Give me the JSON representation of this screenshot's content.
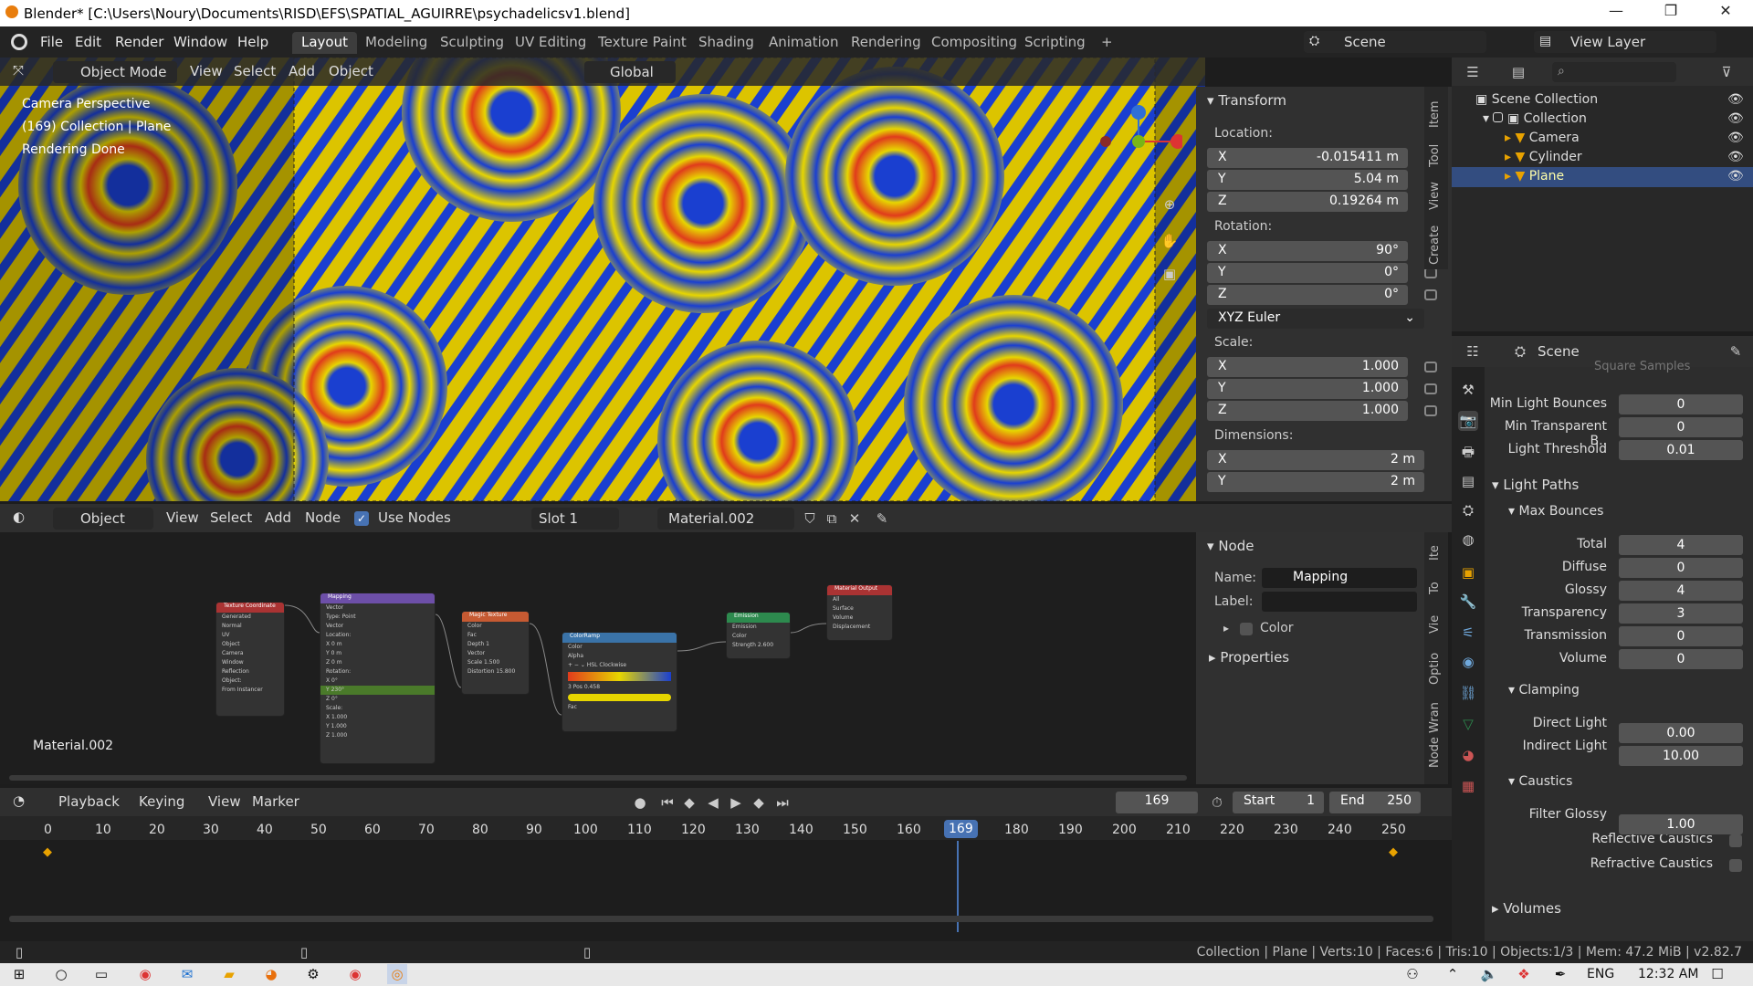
{
  "titlebar": {
    "title": "Blender* [C:\\Users\\Noury\\Documents\\RISD\\EFS\\SPATIAL_AGUIRRE\\psychadelicsv1.blend]",
    "minimize": "—",
    "maximize": "❐",
    "close": "✕"
  },
  "menu": [
    "File",
    "Edit",
    "Render",
    "Window",
    "Help"
  ],
  "workspaces": [
    "Layout",
    "Modeling",
    "Sculpting",
    "UV Editing",
    "Texture Paint",
    "Shading",
    "Animation",
    "Rendering",
    "Compositing",
    "Scripting",
    "+"
  ],
  "scene": {
    "label": "Scene",
    "view_layer": "View Layer"
  },
  "viewport": {
    "mode": "Object Mode",
    "menus": [
      "View",
      "Select",
      "Add",
      "Object"
    ],
    "orientation": "Global",
    "overlay_lines": [
      "Camera Perspective",
      "(169) Collection | Plane",
      "Rendering Done"
    ]
  },
  "npanel": {
    "title": "Transform",
    "tabs": [
      "Item",
      "Tool",
      "View",
      "Create"
    ],
    "location_label": "Location:",
    "location": [
      {
        "axis": "X",
        "value": "-0.015411 m"
      },
      {
        "axis": "Y",
        "value": "5.04 m"
      },
      {
        "axis": "Z",
        "value": "0.19264 m"
      }
    ],
    "rotation_label": "Rotation:",
    "rotation": [
      {
        "axis": "X",
        "value": "90°"
      },
      {
        "axis": "Y",
        "value": "0°"
      },
      {
        "axis": "Z",
        "value": "0°"
      }
    ],
    "rotation_mode": "XYZ Euler",
    "scale_label": "Scale:",
    "scale": [
      {
        "axis": "X",
        "value": "1.000"
      },
      {
        "axis": "Y",
        "value": "1.000"
      },
      {
        "axis": "Z",
        "value": "1.000"
      }
    ],
    "dimensions_label": "Dimensions:",
    "dimensions": [
      {
        "axis": "X",
        "value": "2 m"
      },
      {
        "axis": "Y",
        "value": "2 m"
      }
    ]
  },
  "nodeeditor": {
    "type": "Object",
    "menus": [
      "View",
      "Select",
      "Add",
      "Node"
    ],
    "use_nodes": "Use Nodes",
    "slot": "Slot 1",
    "material": "Material.002",
    "corner_label": "Material.002",
    "panel_title": "Node",
    "name_label": "Name:",
    "name_value": "Mapping",
    "label_label": "Label:",
    "color_label": "Color",
    "properties_label": "Properties",
    "tabs": [
      "Ite",
      "To",
      "Vie",
      "Optio",
      "Node Wran"
    ],
    "nodes": [
      {
        "title": "Texture Coordinate",
        "color": "#a33",
        "lines": [
          "Generated",
          "Normal",
          "UV",
          "Object",
          "Camera",
          "Window",
          "Reflection",
          "Object:",
          "From Instancer"
        ]
      },
      {
        "title": "Mapping",
        "color": "#6d4fa8",
        "lines": [
          "Vector",
          "Type: Point",
          "Vector",
          "Location:",
          "X 0 m",
          "Y 0 m",
          "Z 0 m",
          "Rotation:",
          "X 0°",
          "Y 230°",
          "Z 0°",
          "Scale:",
          "X 1.000",
          "Y 1.000",
          "Z 1.000"
        ]
      },
      {
        "title": "Magic Texture",
        "color": "#c65a32",
        "lines": [
          "Color",
          "Fac",
          "Depth 1",
          "Vector",
          "Scale 1.500",
          "Distortion 15.800"
        ]
      },
      {
        "title": "ColorRamp",
        "color": "#3a73a8",
        "lines": [
          "Color",
          "Alpha",
          "+ − ⌄ HSL Clockwise",
          "3 Pos 0.458",
          "Fac"
        ]
      },
      {
        "title": "Emission",
        "color": "#2d8a4e",
        "lines": [
          "Emission",
          "Color",
          "Strength 2.600"
        ]
      },
      {
        "title": "Material Output",
        "color": "#a33",
        "lines": [
          "All",
          "Surface",
          "Volume",
          "Displacement"
        ]
      }
    ]
  },
  "timeline": {
    "menus": [
      "Playback",
      "Keying",
      "View",
      "Marker"
    ],
    "current_frame": "169",
    "start_label": "Start",
    "start": "1",
    "end_label": "End",
    "end": "250",
    "ticks": [
      "0",
      "10",
      "20",
      "30",
      "40",
      "50",
      "60",
      "70",
      "80",
      "90",
      "100",
      "110",
      "120",
      "130",
      "140",
      "150",
      "160",
      "169",
      "180",
      "190",
      "200",
      "210",
      "220",
      "230",
      "240",
      "250"
    ]
  },
  "outliner": {
    "items": [
      {
        "label": "Scene Collection"
      },
      {
        "label": "Collection"
      },
      {
        "label": "Camera"
      },
      {
        "label": "Cylinder"
      },
      {
        "label": "Plane",
        "selected": true
      }
    ]
  },
  "properties": {
    "context": "Scene",
    "cut_text": "Square Samples",
    "rows1": [
      {
        "label": "Min Light Bounces",
        "value": "0"
      },
      {
        "label": "Min Transparent B..",
        "value": "0"
      },
      {
        "label": "Light Threshold",
        "value": "0.01"
      }
    ],
    "light_paths": "Light Paths",
    "max_bounces": "Max Bounces",
    "bounces": [
      {
        "label": "Total",
        "value": "4"
      },
      {
        "label": "Diffuse",
        "value": "0"
      },
      {
        "label": "Glossy",
        "value": "4"
      },
      {
        "label": "Transparency",
        "value": "3"
      },
      {
        "label": "Transmission",
        "value": "0"
      },
      {
        "label": "Volume",
        "value": "0"
      }
    ],
    "clamping": "Clamping",
    "clamp": [
      {
        "label": "Direct Light",
        "value": "0.00"
      },
      {
        "label": "Indirect Light",
        "value": "10.00"
      }
    ],
    "caustics": "Caustics",
    "filter_glossy_label": "Filter Glossy",
    "filter_glossy": "1.00",
    "reflective": "Reflective Caustics",
    "refractive": "Refractive Caustics",
    "volumes": "Volumes"
  },
  "statusbar": {
    "text": "Collection | Plane | Verts:10 | Faces:6 | Tris:10 | Objects:1/3 | Mem: 47.2 MiB | v2.82.7"
  },
  "taskbar": {
    "lang": "ENG",
    "time": "12:32 AM"
  },
  "colors": {
    "accent": "#4772b3",
    "selected_row": "#334d80",
    "frame_marker": "#4772b3"
  }
}
